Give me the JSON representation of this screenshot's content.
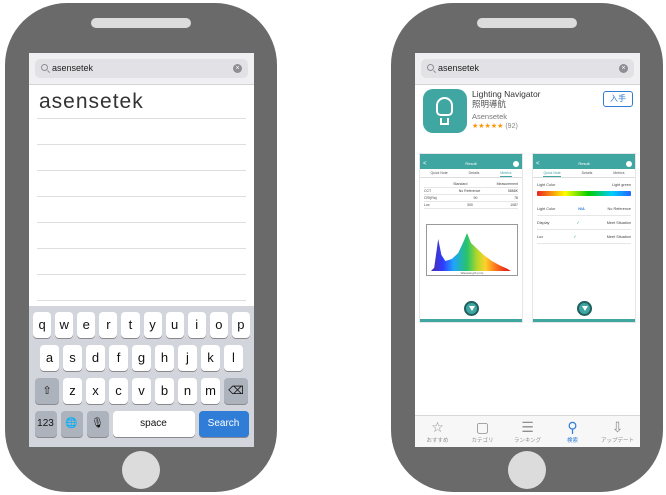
{
  "left_phone": {
    "search_query": "asensetek",
    "clear_glyph": "×",
    "suggestion": "asensetek",
    "keyboard": {
      "row1": [
        "q",
        "w",
        "e",
        "r",
        "t",
        "y",
        "u",
        "i",
        "o",
        "p"
      ],
      "row2": [
        "a",
        "s",
        "d",
        "f",
        "g",
        "h",
        "j",
        "k",
        "l"
      ],
      "row3": [
        "z",
        "x",
        "c",
        "v",
        "b",
        "n",
        "m"
      ],
      "shift_glyph": "⇧",
      "delete_glyph": "⌫",
      "numbers_label": "123",
      "globe_glyph": "🌐",
      "mic_glyph": "🎙",
      "space_label": "space",
      "search_label": "Search"
    }
  },
  "right_phone": {
    "search_query": "asensetek",
    "clear_glyph": "×",
    "app": {
      "name": "Lighting Navigator",
      "subtitle": "照明導航",
      "developer": "Asensetek",
      "stars": "★★★★★",
      "rating_count": "(92)",
      "get_label": "入手"
    },
    "screenshot1": {
      "nav_title": "Result",
      "tabs": [
        "Quick Note",
        "Details",
        "Metrics"
      ],
      "table_header": [
        "",
        "Standard",
        "Measurement"
      ],
      "rows": [
        [
          "CCT",
          "No Reference",
          "5886K"
        ],
        [
          "CRI(Ra)",
          "90",
          "78"
        ],
        [
          "Lux",
          "300",
          "1087"
        ]
      ],
      "spectrum_xlabel": "Wavelength (nm)"
    },
    "screenshot2": {
      "nav_title": "Result",
      "tabs": [
        "Quick Note",
        "Details",
        "Metrics"
      ],
      "light_color_label": "Light Color",
      "light_color_value": "Light green",
      "rows": [
        {
          "label": "Light Color",
          "mark": "N/A",
          "result": "No Reference"
        },
        {
          "label": "Display",
          "mark": "✓",
          "result": "Meet Situation"
        },
        {
          "label": "Lux",
          "mark": "✓",
          "result": "Meet Situation"
        }
      ]
    },
    "tab_bar": [
      {
        "icon": "star-icon",
        "glyph": "☆",
        "label": "おすすめ",
        "active": false
      },
      {
        "icon": "categories-icon",
        "glyph": "▢",
        "label": "カテゴリ",
        "active": false
      },
      {
        "icon": "ranking-icon",
        "glyph": "☰",
        "label": "ランキング",
        "active": false
      },
      {
        "icon": "search-icon",
        "glyph": "⚲",
        "label": "検索",
        "active": true
      },
      {
        "icon": "updates-icon",
        "glyph": "⇩",
        "label": "アップデート",
        "active": false
      }
    ],
    "colors": {
      "teal": "#3fa6a2",
      "blue": "#2f7dd6",
      "phone_body": "#6a6a6a"
    }
  }
}
